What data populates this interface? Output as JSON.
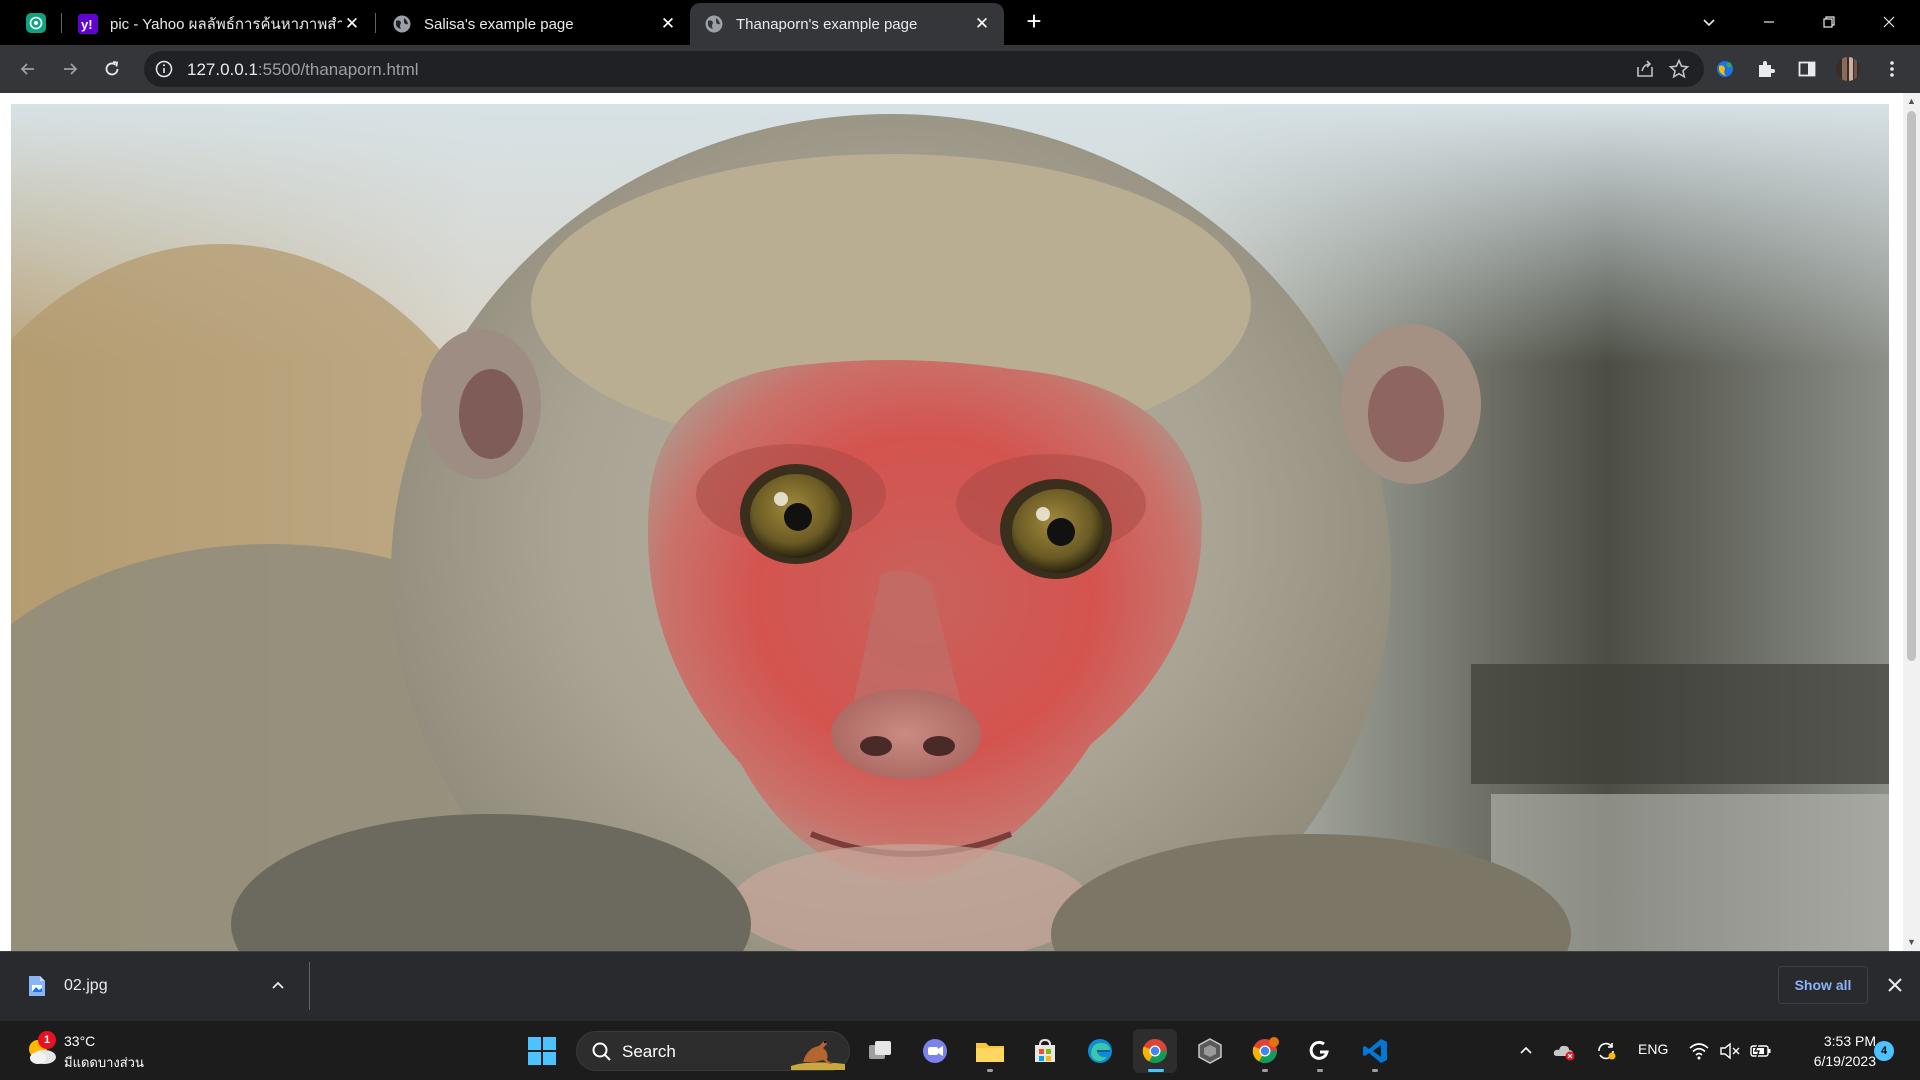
{
  "browser": {
    "tabs": [
      {
        "title": "pic - Yahoo ผลลัพธ์การค้นหาภาพสำหร",
        "favicon": "yahoo-icon",
        "active": false
      },
      {
        "title": "Salisa's example page",
        "favicon": "globe-icon",
        "active": false
      },
      {
        "title": "Thanaporn's example page",
        "favicon": "globe-icon",
        "active": true
      }
    ],
    "address": {
      "host": "127.0.0.1",
      "rest": ":5500/thanaporn.html"
    }
  },
  "page": {
    "image_alt": "monkey-photo"
  },
  "downloads": {
    "file_name": "02.jpg",
    "show_all_label": "Show all"
  },
  "taskbar": {
    "weather_temp": "33°C",
    "weather_condition": "มีแดดบางส่วน",
    "weather_badge": "1",
    "search_label": "Search",
    "language": "ENG",
    "time": "3:53 PM",
    "date": "6/19/2023",
    "notification_count": "4"
  },
  "colors": {
    "tabstrip": "#000000",
    "active_tab": "#35363a",
    "taskbar": "#1c1c1c",
    "accent": "#4cc2ff",
    "link": "#8ab4f8"
  }
}
